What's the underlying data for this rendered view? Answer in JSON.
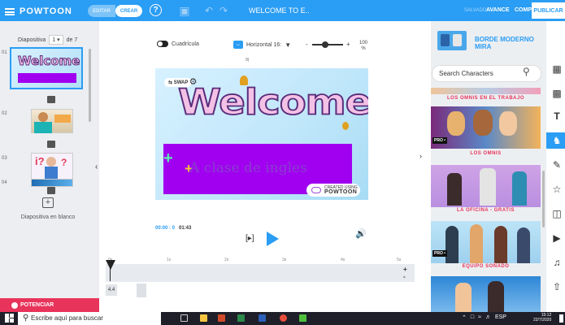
{
  "topbar": {
    "brand": "POWTOON",
    "mode_edit": "EDITAR",
    "mode_create": "CREAR",
    "doc_title": "WELCOME TO E..",
    "saved": "SALVADO",
    "preview": "AVANCE",
    "share": "COMPARTIR",
    "publish": "PUBLICAR"
  },
  "leftpanel": {
    "slide_label": "Diapositiva",
    "slide_current": "1 ▾",
    "slide_total": "de 7",
    "thumbs": [
      "01",
      "02",
      "03",
      "04"
    ],
    "blank_slide": "Diapositiva en blanco",
    "boost": "POTENCIAR"
  },
  "toolbar": {
    "grid": "Cuadrícula",
    "orientation": "Horizontal 16:",
    "zoom": "100 %",
    "stage_marker": "9)"
  },
  "stage": {
    "heading": "Welcome",
    "subtitle": "A clase de ingles",
    "swap": "SWAP",
    "credit_small": "CREATED USING",
    "credit_brand": "POWTOON"
  },
  "playback": {
    "current": "00:00 : 0",
    "total": "01:43",
    "ticks": [
      "0s",
      "1s",
      "2s",
      "3s",
      "4s",
      "5s"
    ],
    "duration_badge": "4.4"
  },
  "rightpanel": {
    "style_title": "BORDE MODERNO MIRA",
    "search_placeholder": "Search Characters",
    "packs": [
      {
        "label": "LOS OMNIS EN EL TRABAJO",
        "pro": ""
      },
      {
        "label": "LOS OMNIS",
        "pro": "PRO •"
      },
      {
        "label": "LA OFICINA - GRATIS",
        "pro": ""
      },
      {
        "label": "EQUIPO SOÑADO",
        "pro": "PRO •"
      }
    ]
  },
  "taskbar": {
    "search": "Escribe aquí para buscar",
    "lang": "ESP",
    "time": "15:12",
    "date": "22/7/2020"
  },
  "colors": {
    "accent": "#2a9df4",
    "danger": "#e8335a",
    "band": "#a100f0"
  }
}
